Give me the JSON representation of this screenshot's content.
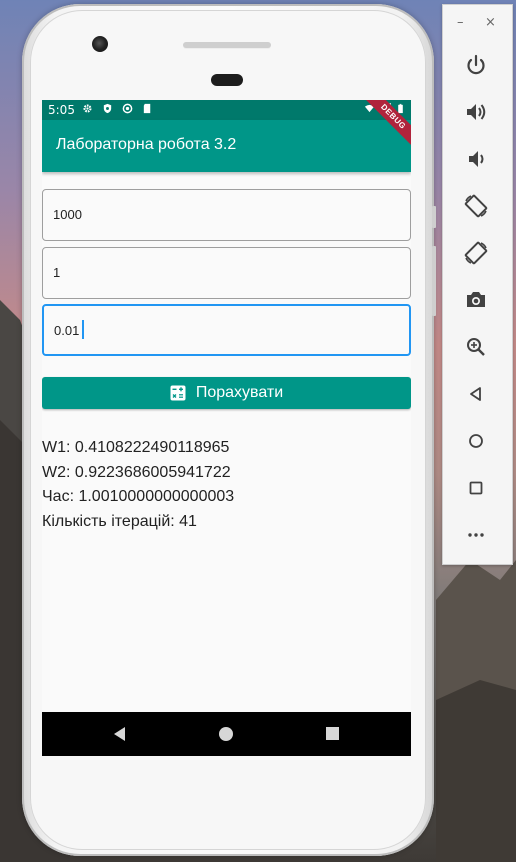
{
  "emulator": {
    "window_controls": {
      "minimize": "–",
      "close": "×"
    },
    "toolbar_buttons": [
      "power-icon",
      "volume-up-icon",
      "volume-down-icon",
      "rotate-left-icon",
      "rotate-right-icon",
      "camera-icon",
      "zoom-icon",
      "back-icon",
      "home-icon",
      "overview-icon",
      "more-icon"
    ]
  },
  "statusbar": {
    "time": "5:05"
  },
  "appbar": {
    "title": "Лабораторна робота 3.2",
    "debug_banner": "DEBUG"
  },
  "inputs": [
    {
      "value": "1000"
    },
    {
      "value": "1"
    },
    {
      "value": "0.01"
    }
  ],
  "button": {
    "label": "Порахувати"
  },
  "results": {
    "w1": "W1: 0.4108222490118965",
    "w2": "W2: 0.9223686005941722",
    "time": "Час: 1.0010000000000003",
    "iterations": "Кількість ітерацій: 41"
  },
  "colors": {
    "primary": "#009688",
    "status": "#00796b",
    "focus": "#2196f3",
    "debug": "#b0243c"
  }
}
